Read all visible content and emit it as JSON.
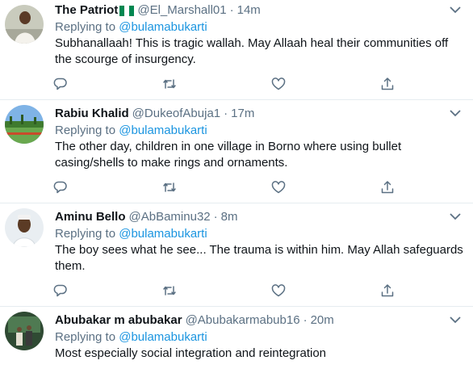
{
  "colors": {
    "text": "#0f1419",
    "muted": "#5b7083",
    "link": "#1b95e0",
    "divider": "#e6ecf0",
    "flag_green": "#008751"
  },
  "tweets": [
    {
      "name": "The Patriot",
      "flag": "nigeria-flag",
      "handle": "@El_Marshall01",
      "sep": "·",
      "time": "14m",
      "replying": "Replying to",
      "reply_to": "@bulamabukarti",
      "text": "Subhanallaah! This is tragic wallah. May Allaah heal their communities off the scourge of insurgency."
    },
    {
      "name": "Rabiu Khalid",
      "handle": "@DukeofAbuja1",
      "sep": "·",
      "time": "17m",
      "replying": "Replying to",
      "reply_to": "@bulamabukarti",
      "text": "The other day, children in one village in Borno where using bullet casing/shells to make rings and ornaments."
    },
    {
      "name": "Aminu Bello",
      "handle": "@AbBaminu32",
      "sep": "·",
      "time": "8m",
      "replying": "Replying to",
      "reply_to": "@bulamabukarti",
      "text": "The boy sees what he see... The trauma is within him. May Allah safeguards them."
    },
    {
      "name": "Abubakar m abubakar",
      "handle": "@Abubakarmabub16",
      "sep": "·",
      "time": "20m",
      "replying": "Replying to",
      "reply_to": "@bulamabukarti",
      "text": "Most especially social integration and reintegration"
    }
  ],
  "icons": {
    "more": "chevron-down-icon",
    "reply": "reply-icon",
    "retweet": "retweet-icon",
    "like": "heart-icon",
    "share": "share-icon"
  }
}
